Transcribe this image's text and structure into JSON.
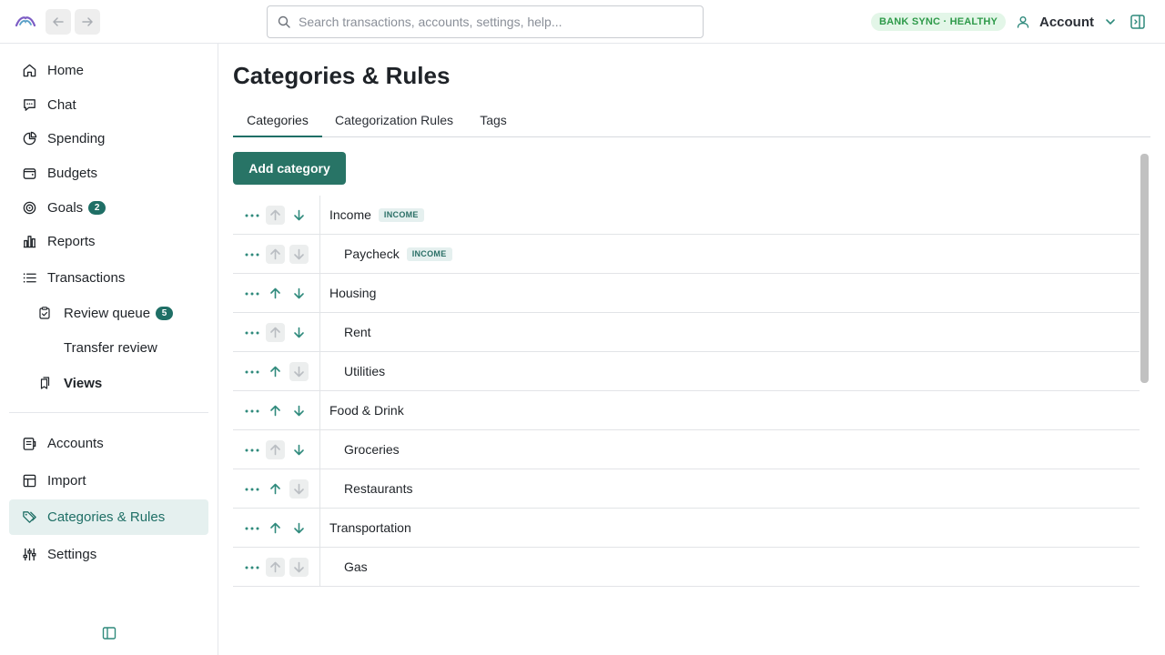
{
  "topbar": {
    "search_placeholder": "Search transactions, accounts, settings, help...",
    "sync_status": "BANK SYNC · HEALTHY",
    "account_label": "Account"
  },
  "sidebar": {
    "items": [
      {
        "label": "Home",
        "icon": "home-icon"
      },
      {
        "label": "Chat",
        "icon": "chat-icon"
      },
      {
        "label": "Spending",
        "icon": "pie-chart-icon"
      },
      {
        "label": "Budgets",
        "icon": "wallet-icon"
      },
      {
        "label": "Goals",
        "icon": "target-icon",
        "count": "2"
      },
      {
        "label": "Reports",
        "icon": "bar-chart-icon"
      },
      {
        "label": "Transactions",
        "icon": "list-icon"
      },
      {
        "label": "Review queue",
        "icon": "clipboard-check-icon",
        "count": "5"
      },
      {
        "label": "Transfer review"
      },
      {
        "label": "Views",
        "icon": "bookmarks-icon"
      },
      {
        "label": "Accounts",
        "icon": "accounts-icon"
      },
      {
        "label": "Import",
        "icon": "import-icon"
      },
      {
        "label": "Categories & Rules",
        "icon": "tags-icon",
        "active": true
      },
      {
        "label": "Settings",
        "icon": "sliders-icon"
      }
    ]
  },
  "main": {
    "title": "Categories & Rules",
    "tabs": [
      {
        "label": "Categories",
        "active": true
      },
      {
        "label": "Categorization Rules"
      },
      {
        "label": "Tags"
      }
    ],
    "add_button": "Add category",
    "categories": [
      {
        "name": "Income",
        "level": 0,
        "badge": "INCOME",
        "up_enabled": false,
        "down_enabled": true
      },
      {
        "name": "Paycheck",
        "level": 1,
        "badge": "INCOME",
        "up_enabled": false,
        "down_enabled": false
      },
      {
        "name": "Housing",
        "level": 0,
        "up_enabled": true,
        "down_enabled": true
      },
      {
        "name": "Rent",
        "level": 1,
        "up_enabled": false,
        "down_enabled": true
      },
      {
        "name": "Utilities",
        "level": 1,
        "up_enabled": true,
        "down_enabled": false
      },
      {
        "name": "Food & Drink",
        "level": 0,
        "up_enabled": true,
        "down_enabled": true
      },
      {
        "name": "Groceries",
        "level": 1,
        "up_enabled": false,
        "down_enabled": true
      },
      {
        "name": "Restaurants",
        "level": 1,
        "up_enabled": true,
        "down_enabled": false
      },
      {
        "name": "Transportation",
        "level": 0,
        "up_enabled": true,
        "down_enabled": true
      },
      {
        "name": "Gas",
        "level": 1,
        "up_enabled": false,
        "down_enabled": false
      }
    ]
  },
  "colors": {
    "accent": "#287466",
    "active_bg": "#e5f0ef",
    "sync_bg": "#e3f6e8",
    "sync_text": "#2e9a4a"
  }
}
